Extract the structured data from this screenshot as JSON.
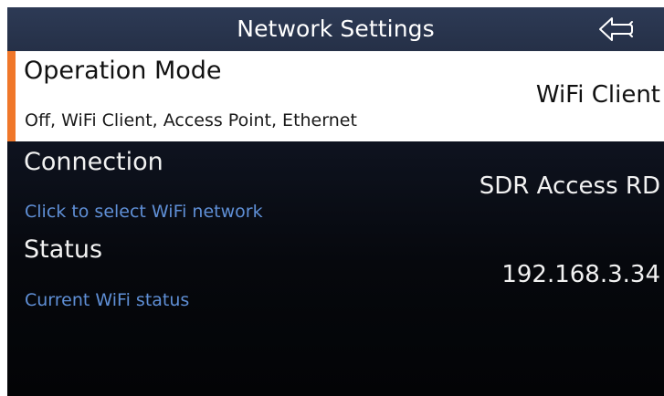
{
  "header": {
    "title": "Network Settings",
    "back_icon": "back-arrow-icon"
  },
  "rows": [
    {
      "title": "Operation Mode",
      "subtitle": "Off, WiFi Client, Access Point, Ethernet",
      "value": "WiFi Client",
      "selected": true
    },
    {
      "title": "Connection",
      "subtitle": "Click to select WiFi network",
      "value": "SDR Access RD",
      "selected": false
    },
    {
      "title": "Status",
      "subtitle": "Current WiFi status",
      "value": "192.168.3.34",
      "selected": false
    }
  ],
  "colors": {
    "accent": "#f0772a",
    "header_bg": "#2d3a55",
    "subtitle_blue": "#5f8fd6",
    "selected_row_bg": "#ffffff",
    "background": "#0d111c"
  }
}
